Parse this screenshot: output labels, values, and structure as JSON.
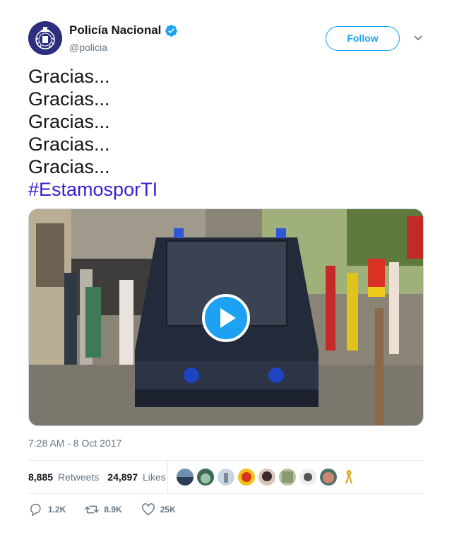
{
  "account": {
    "display_name": "Policía Nacional",
    "handle": "@policia",
    "verified": true,
    "avatar_icon": "police-badge-icon",
    "follow_label": "Follow"
  },
  "tweet": {
    "lines": [
      "Gracias...",
      "Gracias...",
      "Gracias...",
      "Gracias...",
      "Gracias..."
    ],
    "hashtag": "#EstamosporTI",
    "media_type": "video",
    "timestamp": "7:28 AM - 8 Oct 2017"
  },
  "stats": {
    "retweets_count": "8,885",
    "retweets_label": "Retweets",
    "likes_count": "24,897",
    "likes_label": "Likes"
  },
  "actions": {
    "reply_count": "1.2K",
    "retweet_count": "8.9K",
    "like_count": "25K"
  },
  "colors": {
    "accent": "#1da1f2",
    "hashtag": "#3b1dd1",
    "muted": "#657786"
  }
}
